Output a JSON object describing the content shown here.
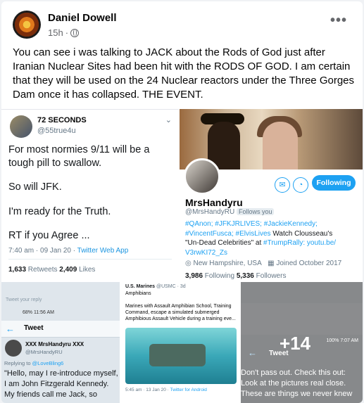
{
  "post": {
    "author": "Daniel Dowell",
    "time": "15h",
    "dot": "·",
    "more": "•••",
    "text": "You can see i was talking to JACK about the Rods of God just after Iranian Nuclear Sites had been hit with the RODS OF GOD. I am certain that they will be used on the 24 Nuclear reactors under the Three Gorges Dam once it has collapsed. THE EVENT."
  },
  "tweet1": {
    "name": "72 SECONDS",
    "handle": "@55true4u",
    "lines": [
      "For most normies 9/11 will be a",
      "tough pill to swallow.",
      "So will JFK.",
      "I'm ready for the Truth.",
      "RT if you Agree ..."
    ],
    "stamp": "7:40 am · 09 Jan 20 · ",
    "app": "Twitter Web App",
    "retweets": "1,633",
    "retweets_label": " Retweets  ",
    "likes": "2,409",
    "likes_label": " Likes"
  },
  "profile": {
    "name": "MrsHandyru",
    "handle": "@MrsHandyRU",
    "follows_you": "Follows you",
    "follow_label": "Following",
    "bio_tags1": "#QAnon; #JFKJRLIVES; #JackieKennedy;",
    "bio_tags2": "#VincentFusca; #ElvisLives",
    "bio_rest2": " Watch Clousseau's",
    "bio_line3a": "\"Un-Dead Celebrities\" at ",
    "bio_line3b": "#TrumpRally",
    "bio_line3c": ": youtu.be/",
    "bio_line4": "V3rwKI72_Zs",
    "location": "New Hampshire, USA",
    "joined": "Joined October 2017",
    "following_count": "3,986",
    "following_label": " Following  ",
    "followers_count": "5,336",
    "followers_label": " Followers"
  },
  "tile1": {
    "reply": "Tweet your reply",
    "status": "68% 11:56 AM",
    "nav_title": "Tweet",
    "name": "XXX MrsHandyru XXX",
    "handle": "@MrsHandyRU",
    "replying": "Replying to ",
    "replying_to": "@LoveBling6",
    "lines": [
      "\"Hello, may I re-introduce myself,",
      "I am John Fitzgerald Kennedy.",
      "My friends call me Jack, so"
    ]
  },
  "tile2": {
    "account": "U.S. Marines",
    "account_meta": " @USMC · 3d",
    "sub": "Amphibians",
    "body": "Marines with Assault Amphibian School, Training Command, escape a simulated submerged Amphibious Assault Vehicle during a training eve...",
    "foot": "5:45 am · 13 Jan 20 · ",
    "foot_app": "Twitter for Android"
  },
  "tile3": {
    "more": "+14",
    "status": "100% 7:07 AM",
    "nav_title": "Tweet",
    "lines": [
      "Don't pass out. Check this out:",
      "Look at the pictures real close.",
      "These are things we never knew"
    ]
  },
  "icons": [
    "globe-icon",
    "more-icon",
    "mail-icon",
    "notify-icon",
    "location-icon",
    "calendar-icon",
    "back-arrow-icon"
  ]
}
